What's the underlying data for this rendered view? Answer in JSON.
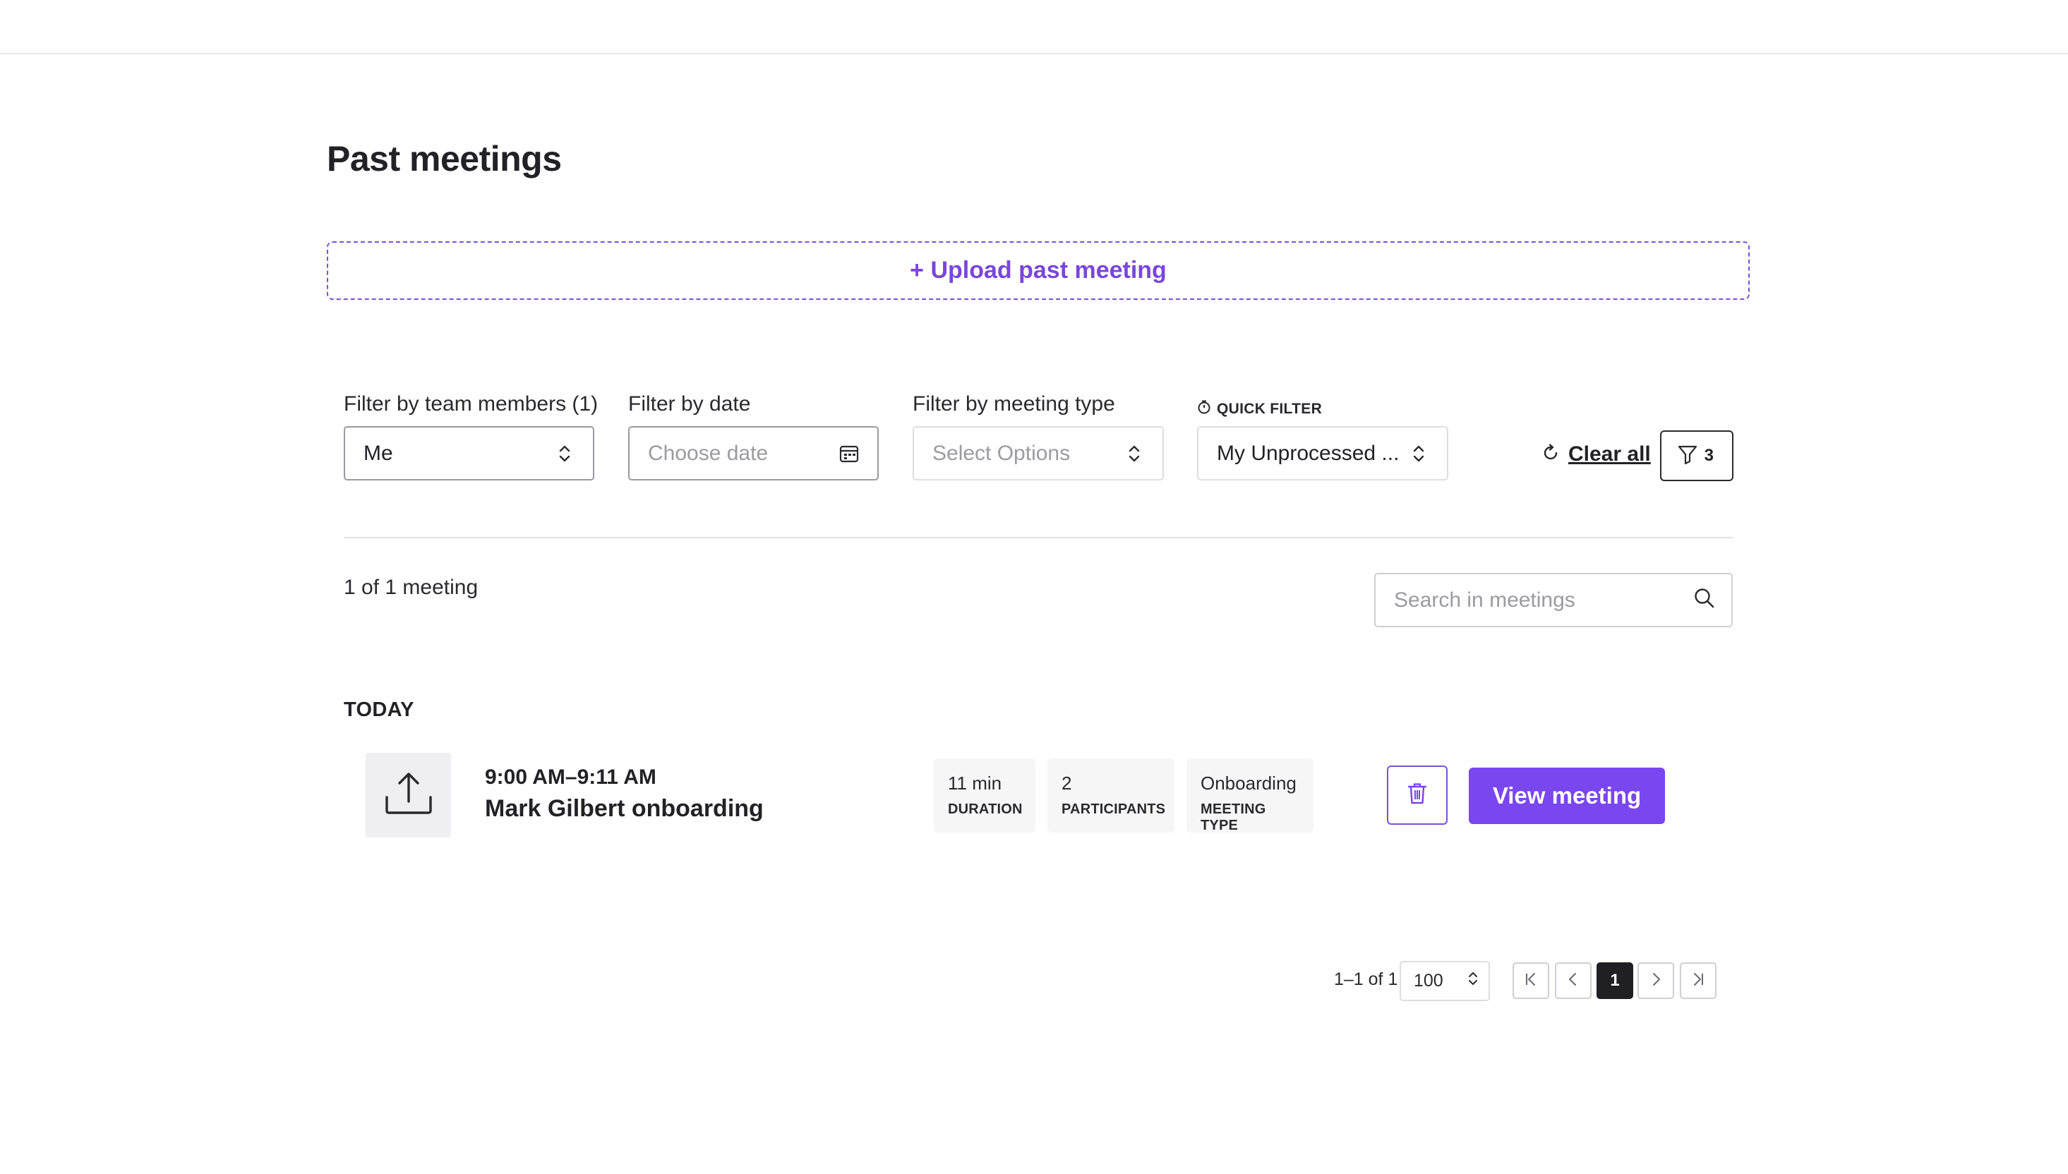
{
  "page": {
    "title": "Past meetings"
  },
  "upload": {
    "label": "+ Upload past meeting"
  },
  "filters": {
    "team_members": {
      "label": "Filter by team members (1)",
      "value": "Me"
    },
    "date": {
      "label": "Filter by date",
      "placeholder": "Choose date"
    },
    "meeting_type": {
      "label": "Filter by meeting type",
      "placeholder": "Select Options"
    },
    "quick_filter": {
      "label": "QUICK FILTER",
      "value": "My Unprocessed ..."
    },
    "clear_all": "Clear all",
    "active_count": "3"
  },
  "results": {
    "count_text": "1 of 1 meeting"
  },
  "search": {
    "placeholder": "Search in meetings"
  },
  "section": {
    "label": "TODAY"
  },
  "meetings": [
    {
      "time": "9:00 AM–9:11 AM",
      "title": "Mark Gilbert onboarding",
      "duration": {
        "value": "11 min",
        "label": "DURATION"
      },
      "participants": {
        "value": "2",
        "label": "PARTICIPANTS"
      },
      "meeting_type": {
        "value": "Onboarding",
        "label": "MEETING TYPE"
      },
      "view_label": "View meeting"
    }
  ],
  "pagination": {
    "range": "1–1 of 1",
    "per_page": "100",
    "current_page": "1"
  },
  "colors": {
    "accent": "#7a46f0",
    "accent_text": "#7a46dc",
    "border": "#dedee2",
    "text": "#222226"
  }
}
